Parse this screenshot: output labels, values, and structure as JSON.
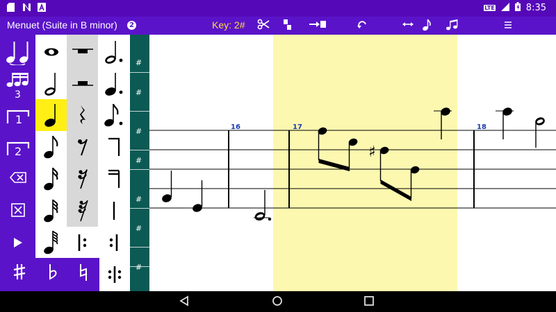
{
  "status_bar": {
    "time": "8:35",
    "network_label": "LTE",
    "icons": [
      "sd-card-icon",
      "n-app-icon",
      "a-app-icon",
      "signal-icon",
      "battery-icon"
    ]
  },
  "toolbar": {
    "title": "Menuet (Suite in B minor)",
    "badge": "2",
    "key": "Key: 2#",
    "buttons": [
      "scissors-icon",
      "copy-icon",
      "move-icon",
      "undo-icon",
      "stretch-icon",
      "note-icon",
      "beam-icon",
      "menu-icon"
    ]
  },
  "left_tools": {
    "tuplet_label": "3",
    "voice1_label": "1",
    "voice2_label": "2",
    "icons": [
      "tie-icon",
      "triplet-icon",
      "voice-1-icon",
      "voice-2-icon",
      "backspace-icon",
      "delete-icon",
      "play-icon"
    ]
  },
  "palette": {
    "selected": "quarter-note",
    "note_column": [
      "whole-note",
      "half-note",
      "quarter-note",
      "eighth-note",
      "sixteenth-note",
      "thirty-second-note",
      "sixty-fourth-note"
    ],
    "rest_column": [
      "whole-rest",
      "half-rest",
      "quarter-rest",
      "eighth-rest",
      "sixteenth-rest",
      "thirty-second-rest",
      "repeat-start"
    ],
    "dotted_column": [
      "dotted-half-note",
      "dotted-quarter-note",
      "dotted-eighth-note",
      "flag-eighth",
      "flag-sixteenth",
      "barline",
      "repeat-end"
    ],
    "bottom_row": [
      "sharp",
      "flat",
      "natural",
      "double-repeat"
    ]
  },
  "ruler": {
    "sharp_glyph": "#"
  },
  "score": {
    "measure_numbers": [
      "16",
      "17",
      "18"
    ],
    "highlight_color": "#fdf8b0",
    "accidental": "♯"
  },
  "colors": {
    "status_purple": "#5508b8",
    "toolbar_purple": "#5a13c9",
    "key_yellow": "#ffde3c",
    "ruler_teal": "#0c5a54",
    "selection_yellow": "#ffef14",
    "measure_blue": "#1a3bb0"
  }
}
